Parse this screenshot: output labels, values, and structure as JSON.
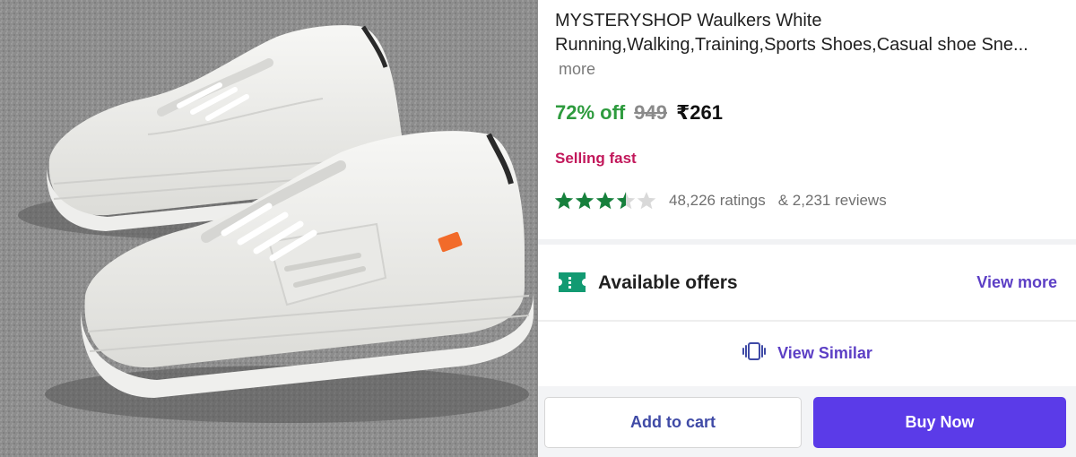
{
  "product": {
    "title": "MYSTERYSHOP Waulkers White Running,Walking,Training,Sports Shoes,Casual shoe Sne...",
    "more_label": "more",
    "image_alt": "white sneakers product photo"
  },
  "pricing": {
    "discount": "72% off",
    "mrp": "949",
    "price": "₹261",
    "discount_color": "#2e9b3e"
  },
  "badge": {
    "selling_fast": "Selling fast",
    "color": "#c2185b"
  },
  "rating": {
    "stars": 3.5,
    "max_stars": 5,
    "ratings_text": "48,226 ratings",
    "reviews_text": "& 2,231 reviews",
    "star_color": "#16803c"
  },
  "offers": {
    "icon": "offer-ticket-icon",
    "label": "Available offers",
    "view_more": "View more"
  },
  "similar": {
    "icon": "view-similar-icon",
    "label": "View Similar"
  },
  "actions": {
    "add_to_cart": "Add to cart",
    "buy_now": "Buy Now",
    "accent": "#5b3be8"
  }
}
